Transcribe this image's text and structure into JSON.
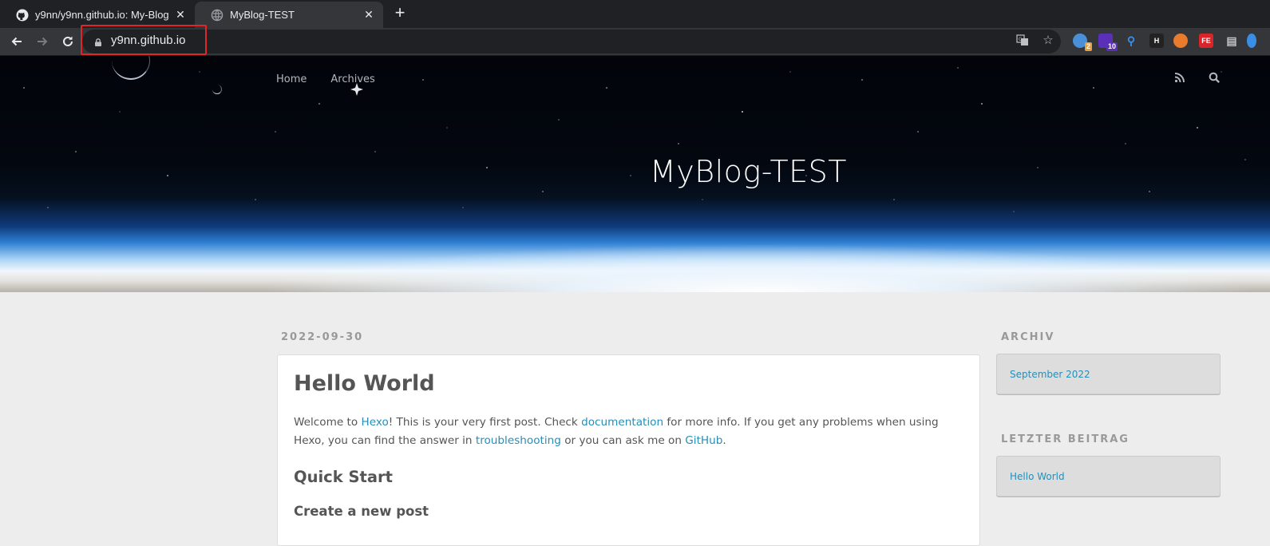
{
  "browser": {
    "tabs": [
      {
        "title": "y9nn/y9nn.github.io: My-Blog",
        "icon": "github-icon",
        "active": false
      },
      {
        "title": "MyBlog-TEST",
        "icon": "globe-icon",
        "active": true
      }
    ],
    "url": "y9nn.github.io",
    "extensions": [
      {
        "name": "extension-1-icon",
        "badge": "2",
        "color": "#4a90d9"
      },
      {
        "name": "extension-2-icon",
        "badge": "10",
        "color": "#5b2fb8"
      },
      {
        "name": "extension-3-icon",
        "color": "#3b8ee6"
      },
      {
        "name": "extension-4-icon",
        "label": "H",
        "color": "#222222"
      },
      {
        "name": "extension-5-icon",
        "color": "#e87c2c"
      },
      {
        "name": "extension-6-icon",
        "label": "FE",
        "color": "#d9252a"
      },
      {
        "name": "extension-7-icon",
        "color": "#bdc1c6"
      }
    ]
  },
  "site": {
    "nav": [
      "Home",
      "Archives"
    ],
    "title": "MyBlog-TEST"
  },
  "post": {
    "date": "2022-09-30",
    "title": "Hello World",
    "intro_parts": {
      "p1": "Welcome to ",
      "link_hexo": "Hexo",
      "p2": "! This is your very first post. Check ",
      "link_docs": "documentation",
      "p3": " for more info. If you get any problems when using Hexo, you can find the answer in ",
      "link_trouble": "troubleshooting",
      "p4": " or you can ask me on ",
      "link_github": "GitHub",
      "p5": "."
    },
    "heading2": "Quick Start",
    "heading3": "Create a new post"
  },
  "sidebar": {
    "archive_title": "ARCHIV",
    "archive_item": "September 2022",
    "recent_title": "LETZTER BEITRAG",
    "recent_item": "Hello World"
  },
  "colors": {
    "link": "#258fb8",
    "highlight": "#e0262a"
  }
}
